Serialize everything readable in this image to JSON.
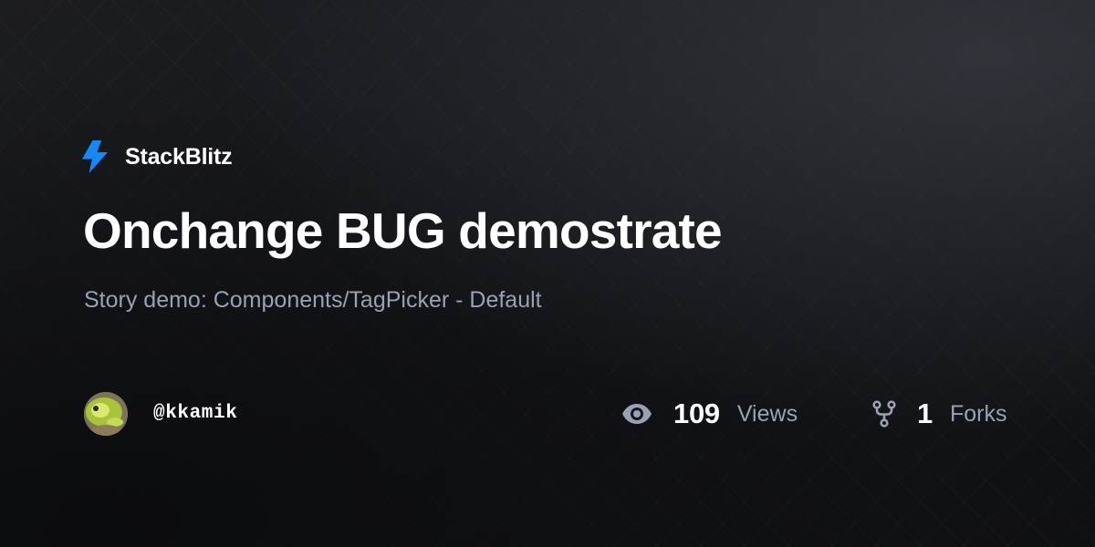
{
  "brand": {
    "name": "StackBlitz",
    "icon": "lightning-bolt-icon",
    "accent_color": "#1389fd"
  },
  "project": {
    "title": "Onchange BUG demostrate",
    "description": "Story demo: Components/TagPicker - Default"
  },
  "author": {
    "handle": "@kkamik",
    "avatar": "frog-avatar"
  },
  "stats": {
    "views": {
      "icon": "eye-icon",
      "count": "109",
      "label": "Views"
    },
    "forks": {
      "icon": "fork-icon",
      "count": "1",
      "label": "Forks"
    }
  },
  "colors": {
    "background": "#15161a",
    "text_primary": "#ffffff",
    "text_secondary": "#98a2b3"
  }
}
